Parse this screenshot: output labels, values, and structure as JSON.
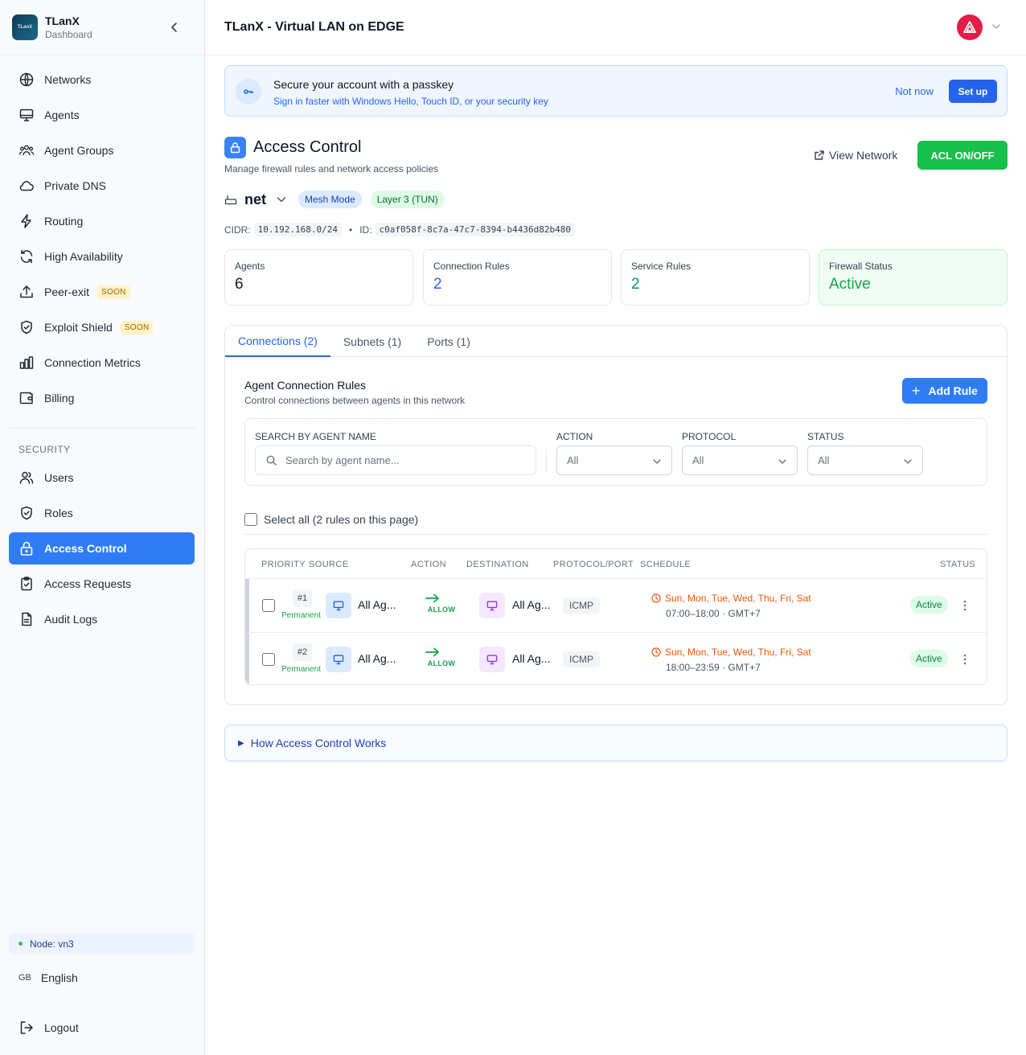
{
  "app": {
    "name": "TLanX",
    "subtitle": "Dashboard",
    "logo_text": "TLanX"
  },
  "header": {
    "title": "TLanX - Virtual LAN on EDGE"
  },
  "sidebar": {
    "items": [
      {
        "label": "Networks",
        "icon": "globe-icon"
      },
      {
        "label": "Agents",
        "icon": "monitor-icon"
      },
      {
        "label": "Agent Groups",
        "icon": "users-group-icon"
      },
      {
        "label": "Private DNS",
        "icon": "cloud-icon"
      },
      {
        "label": "Routing",
        "icon": "bolt-icon"
      },
      {
        "label": "High Availability",
        "icon": "refresh-icon"
      },
      {
        "label": "Peer-exit",
        "icon": "upload-icon",
        "badge": "SOON"
      },
      {
        "label": "Exploit Shield",
        "icon": "shield-check-icon",
        "badge": "SOON"
      },
      {
        "label": "Connection Metrics",
        "icon": "bar-chart-icon"
      },
      {
        "label": "Billing",
        "icon": "wallet-icon"
      }
    ],
    "security_label": "SECURITY",
    "security_items": [
      {
        "label": "Users",
        "icon": "users-icon"
      },
      {
        "label": "Roles",
        "icon": "shield-check-icon"
      },
      {
        "label": "Access Control",
        "icon": "lock-icon",
        "active": true
      },
      {
        "label": "Access Requests",
        "icon": "clipboard-check-icon"
      },
      {
        "label": "Audit Logs",
        "icon": "file-icon"
      }
    ],
    "node": "Node: vn3",
    "language_flag": "GB",
    "language": "English",
    "logout": "Logout"
  },
  "banner": {
    "title": "Secure your account with a passkey",
    "subtitle": "Sign in faster with Windows Hello, Touch ID, or your security key",
    "not_now": "Not now",
    "setup": "Set up"
  },
  "page": {
    "title": "Access Control",
    "subtitle": "Manage firewall rules and network access policies",
    "view_network": "View Network",
    "acl_toggle": "ACL ON/OFF"
  },
  "network": {
    "name": "net",
    "mode": "Mesh Mode",
    "layer": "Layer 3 (TUN)",
    "cidr_label": "CIDR:",
    "cidr": "10.192.168.0/24",
    "id_label": "ID:",
    "id": "c0af058f-8c7a-47c7-8394-b4436d82b480"
  },
  "stats": [
    {
      "label": "Agents",
      "value": "6"
    },
    {
      "label": "Connection Rules",
      "value": "2"
    },
    {
      "label": "Service Rules",
      "value": "2"
    },
    {
      "label": "Firewall Status",
      "value": "Active"
    }
  ],
  "tabs": [
    {
      "label": "Connections (2)",
      "active": true
    },
    {
      "label": "Subnets (1)"
    },
    {
      "label": "Ports (1)"
    }
  ],
  "rules": {
    "title": "Agent Connection Rules",
    "subtitle": "Control connections between agents in this network",
    "add_rule": "Add Rule",
    "filters": {
      "search_label": "SEARCH BY AGENT NAME",
      "search_placeholder": "Search by agent name...",
      "action_label": "ACTION",
      "action_value": "All",
      "protocol_label": "PROTOCOL",
      "protocol_value": "All",
      "status_label": "STATUS",
      "status_value": "All"
    },
    "select_all": "Select all (2 rules on this page)",
    "columns": [
      "PRIORITY",
      "SOURCE",
      "ACTION",
      "DESTINATION",
      "PROTOCOL/PORT",
      "SCHEDULE",
      "STATUS"
    ],
    "rows": [
      {
        "priority": "#1",
        "duration": "Permanent",
        "source": "All Ag...",
        "action": "ALLOW",
        "destination": "All Ag...",
        "protocol": "ICMP",
        "days": "Sun, Mon, Tue, Wed, Thu, Fri, Sat",
        "time": "07:00–18:00 · GMT+7",
        "status": "Active"
      },
      {
        "priority": "#2",
        "duration": "Permanent",
        "source": "All Ag...",
        "action": "ALLOW",
        "destination": "All Ag...",
        "protocol": "ICMP",
        "days": "Sun, Mon, Tue, Wed, Thu, Fri, Sat",
        "time": "18:00–23:59 · GMT+7",
        "status": "Active"
      }
    ]
  },
  "how": {
    "label": "How Access Control Works"
  },
  "colors": {
    "primary": "#2f7cf6",
    "success": "#16c04a",
    "avatar": "#e11d48",
    "warning": "#ea580c"
  }
}
